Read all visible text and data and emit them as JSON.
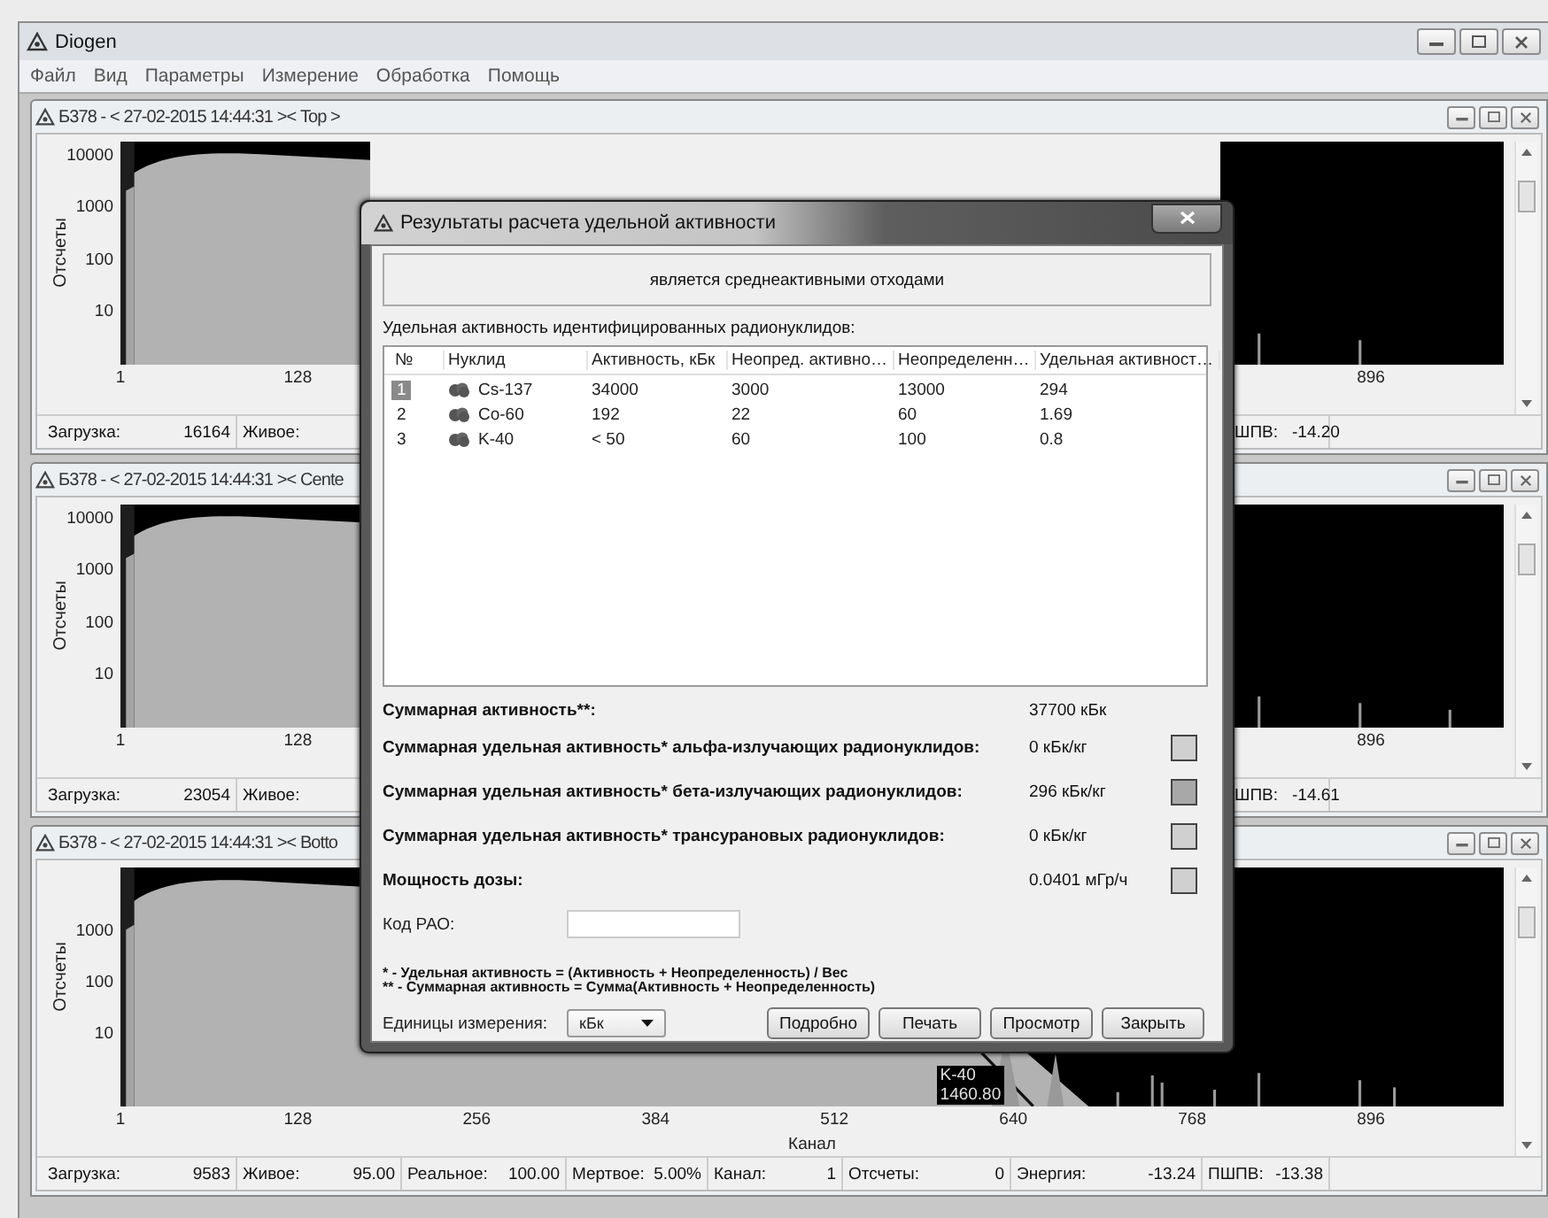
{
  "window": {
    "title": "Diogen"
  },
  "menu": [
    "Файл",
    "Вид",
    "Параметры",
    "Измерение",
    "Обработка",
    "Помощь"
  ],
  "spectrum_windows": [
    {
      "title": "Б378 - < 27-02-2015 14:44:31 >< Top >",
      "y_axis_label": "Отсчеты",
      "y_ticks": [
        "10000",
        "1000",
        "100",
        "10"
      ],
      "x_ticks": [
        "1",
        "128",
        "896"
      ],
      "status": [
        {
          "label": "Загрузка:",
          "value": "16164"
        },
        {
          "label": "Живое:"
        },
        {
          "label": "ШПВ:",
          "value": "-14.20"
        }
      ]
    },
    {
      "title": "Б378 - < 27-02-2015 14:44:31 >< Cente",
      "y_axis_label": "Отсчеты",
      "y_ticks": [
        "10000",
        "1000",
        "100",
        "10"
      ],
      "x_ticks": [
        "1",
        "128",
        "896"
      ],
      "status": [
        {
          "label": "Загрузка:",
          "value": "23054"
        },
        {
          "label": "Живое:"
        },
        {
          "label": "ШПВ:",
          "value": "-14.61"
        }
      ]
    },
    {
      "title": "Б378 - < 27-02-2015 14:44:31 >< Botto",
      "y_axis_label": "Отсчеты",
      "y_ticks": [
        "1000",
        "100",
        "10"
      ],
      "x_ticks": [
        "1",
        "128",
        "256",
        "384",
        "512",
        "640",
        "768",
        "896"
      ],
      "x_axis_label": "Канал",
      "peak_label": [
        "K-40",
        "1460.80"
      ],
      "status": [
        {
          "label": "Загрузка:",
          "value": "9583"
        },
        {
          "label": "Живое:",
          "value": "95.00"
        },
        {
          "label": "Реальное:",
          "value": "100.00"
        },
        {
          "label": "Мертвое:",
          "value": "5.00%"
        },
        {
          "label": "Канал:",
          "value": "1"
        },
        {
          "label": "Отсчеты:",
          "value": "0"
        },
        {
          "label": "Энергия:",
          "value": "-13.24"
        },
        {
          "label": "ПШПВ:",
          "value": "-13.38"
        }
      ]
    }
  ],
  "dialog": {
    "title": "Результаты расчета удельной активности",
    "verdict": "является среднеактивными отходами",
    "table_caption": "Удельная активность идентифицированных радионуклидов:",
    "columns": [
      "№",
      "Нуклид",
      "Активность, кБк",
      "Неопред. активно…",
      "Неопределенн…",
      "Удельная активност…"
    ],
    "rows": [
      {
        "cells": [
          "1",
          "Cs-137",
          "34000",
          "3000",
          "13000",
          "294"
        ],
        "selected": true
      },
      {
        "cells": [
          "2",
          "Co-60",
          "192",
          "22",
          "60",
          "1.69"
        ],
        "selected": false
      },
      {
        "cells": [
          "3",
          "K-40",
          "< 50",
          "60",
          "100",
          "0.8"
        ],
        "selected": false
      }
    ],
    "totals": [
      {
        "label": "Суммарная активность**:",
        "value": "37700 кБк"
      },
      {
        "label": "Суммарная удельная активность* альфа-излучающих радионуклидов:",
        "value": "0 кБк/кг",
        "color": "#d0d0d0"
      },
      {
        "label": "Суммарная удельная активность* бета-излучающих радионуклидов:",
        "value": "296 кБк/кг",
        "color": "#a8a8a8"
      },
      {
        "label": "Суммарная удельная активность* трансурановых радионуклидов:",
        "value": "0 кБк/кг",
        "color": "#d0d0d0"
      },
      {
        "label": "Мощность дозы:",
        "value": "0.0401 мГр/ч",
        "color": "#d0d0d0"
      }
    ],
    "code_label": "Код РАО:",
    "footnotes": [
      "* - Удельная активность = (Активность + Неопределенность) / Вес",
      "** - Суммарная активность = Сумма(Активность + Неопределенность)"
    ],
    "units_label": "Единицы измерения:",
    "units_value": "кБк",
    "buttons": [
      "Подробно",
      "Печать",
      "Просмотр",
      "Закрыть"
    ]
  }
}
